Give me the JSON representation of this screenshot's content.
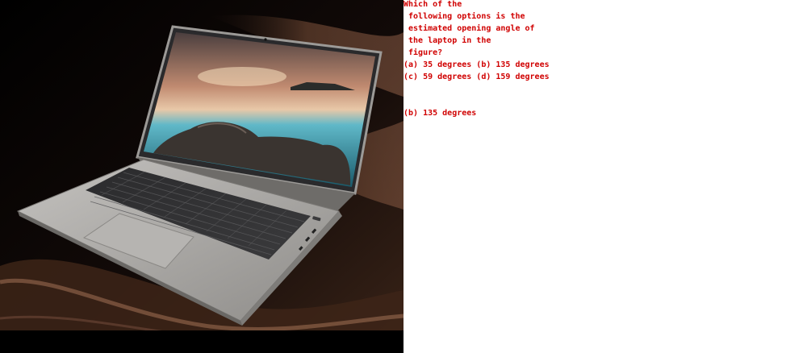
{
  "question": {
    "lines": [
      "Which of the",
      " following options is the",
      " estimated opening angle of",
      " the laptop in the",
      " figure?",
      "(a) 35 degrees (b) 135 degrees",
      "(c) 59 degrees (d) 159 degrees"
    ]
  },
  "answer": "(b) 135 degrees",
  "colors": {
    "text": "#d00000",
    "background": "#000000",
    "laptop_body": "#a9a7a4"
  },
  "image": {
    "subject": "laptop-icon"
  }
}
